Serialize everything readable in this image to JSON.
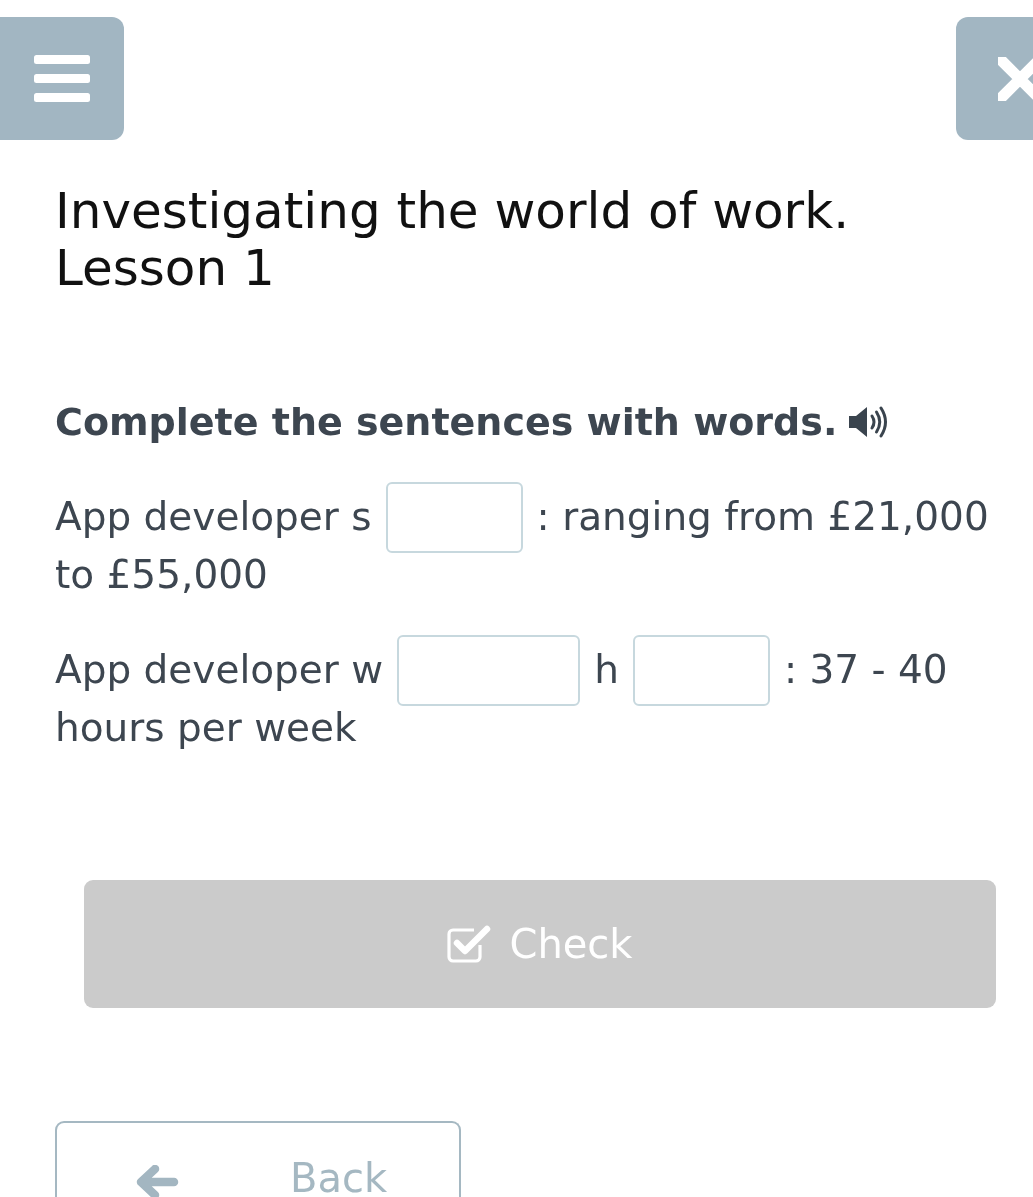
{
  "lesson_title": "Investigating the world of work. Lesson 1",
  "task": {
    "instruction": "Complete the sentences with words.",
    "audio": true
  },
  "sentences": [
    {
      "parts": [
        {
          "kind": "text",
          "text": "App developer s"
        },
        {
          "kind": "blank"
        },
        {
          "kind": "text",
          "text": ": ranging from £21,000"
        },
        {
          "kind": "text",
          "text": "to £55,000"
        }
      ]
    },
    {
      "parts": [
        {
          "kind": "text",
          "text": "App developer w"
        },
        {
          "kind": "blank"
        },
        {
          "kind": "text",
          "text": "h"
        },
        {
          "kind": "blank"
        },
        {
          "kind": "text",
          "text": ": 37 - 40"
        },
        {
          "kind": "text",
          "text": "hours per week"
        }
      ]
    }
  ],
  "check_button": {
    "label": "Check",
    "disabled": true
  },
  "back_button": {
    "label": "Back"
  }
}
